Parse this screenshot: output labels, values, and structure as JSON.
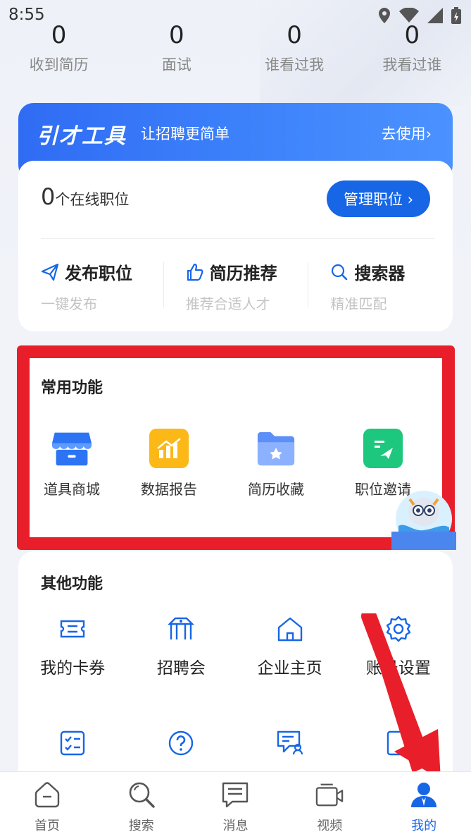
{
  "status": {
    "time": "8:55"
  },
  "stats": [
    {
      "value": "0",
      "label": "收到简历"
    },
    {
      "value": "0",
      "label": "面试"
    },
    {
      "value": "0",
      "label": "谁看过我"
    },
    {
      "value": "0",
      "label": "我看过谁"
    }
  ],
  "tools": {
    "logo": "引才工具",
    "slogan": "让招聘更简单",
    "go": "去使用›",
    "online_count": "0",
    "online_suffix": "个在线职位",
    "manage": "管理职位 ›",
    "quick": [
      {
        "title": "发布职位",
        "sub": "一键发布"
      },
      {
        "title": "简历推荐",
        "sub": "推荐合适人才"
      },
      {
        "title": "搜索器",
        "sub": "精准匹配"
      }
    ]
  },
  "common": {
    "title": "常用功能",
    "items": [
      "道具商城",
      "数据报告",
      "简历收藏",
      "职位邀请"
    ]
  },
  "other": {
    "title": "其他功能",
    "row1": [
      "我的卡券",
      "招聘会",
      "企业主页",
      "账号设置"
    ]
  },
  "tabs": [
    "首页",
    "搜索",
    "消息",
    "视频",
    "我的"
  ],
  "colors": {
    "accent": "#1766e6",
    "highlight": "#e81f2a"
  }
}
